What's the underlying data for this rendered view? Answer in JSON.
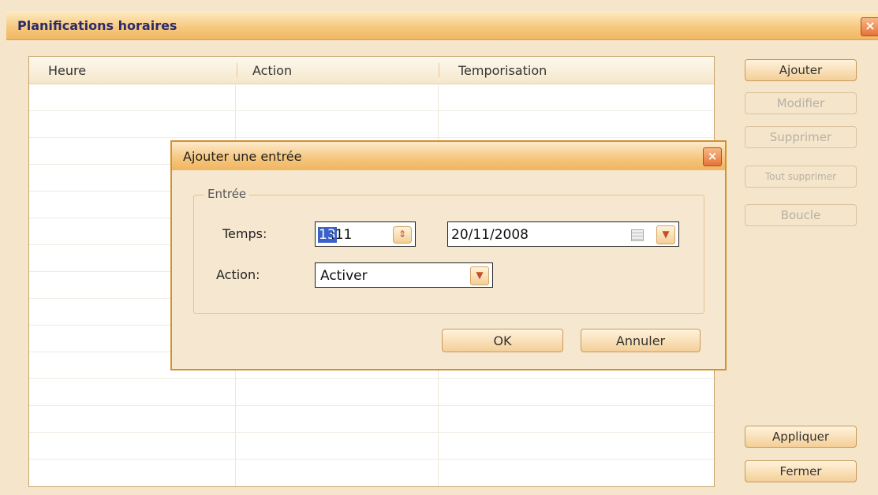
{
  "window": {
    "title": "Planifications horaires",
    "close_glyph": "×"
  },
  "list": {
    "columns": [
      "Heure",
      "Action",
      "Temporisation"
    ]
  },
  "side_buttons": {
    "add": "Ajouter",
    "modify": "Modifier",
    "delete": "Supprimer",
    "delete_all": "Tout supprimer",
    "loop": "Boucle",
    "apply": "Appliquer",
    "close": "Fermer"
  },
  "dialog": {
    "title": "Ajouter une entrée",
    "close_glyph": "×",
    "group_label": "Entrée",
    "time_label": "Temps:",
    "time_hour": "13",
    "time_rest": ":11",
    "date_value": "20/11/2008",
    "action_label": "Action:",
    "action_value": "Activer",
    "ok": "OK",
    "cancel": "Annuler"
  },
  "icons": {
    "spin": "spinner-icon",
    "dropdown": "chevron-down-icon",
    "calendar": "calendar-icon"
  }
}
